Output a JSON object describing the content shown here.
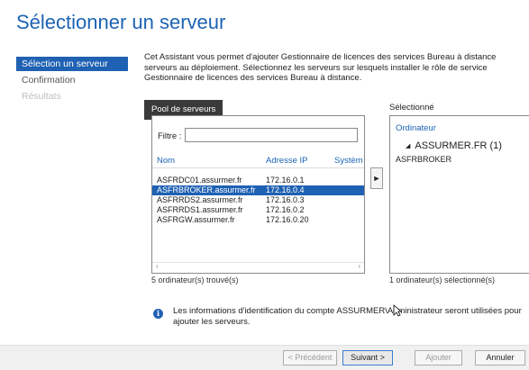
{
  "page": {
    "title": "Sélectionner un serveur"
  },
  "steps": [
    {
      "label": "Sélection un serveur",
      "state": "active"
    },
    {
      "label": "Confirmation",
      "state": "normal"
    },
    {
      "label": "Résultats",
      "state": "disabled"
    }
  ],
  "description": "Cet Assistant vous permet d'ajouter Gestionnaire de licences des services Bureau à distance serveurs au déploiement. Sélectionnez les serveurs sur lesquels installer le rôle de service Gestionnaire de licences des services Bureau à distance.",
  "pool": {
    "tab_label": "Pool de serveurs",
    "filter_label": "Filtre :",
    "filter_value": "",
    "columns": [
      "Nom",
      "Adresse IP",
      "Systèm"
    ],
    "rows": [
      {
        "name": "ASFRDC01.assurmer.fr",
        "ip": "172.16.0.1",
        "selected": false
      },
      {
        "name": "ASFRBROKER.assurmer.fr",
        "ip": "172.16.0.4",
        "selected": true
      },
      {
        "name": "ASFRRDS2.assurmer.fr",
        "ip": "172.16.0.3",
        "selected": false
      },
      {
        "name": "ASFRRDS1.assurmer.fr",
        "ip": "172.16.0.2",
        "selected": false
      },
      {
        "name": "ASFRGW.assurmer.fr",
        "ip": "172.16.0.20",
        "selected": false
      }
    ],
    "scroll_left": "‹",
    "scroll_right": "›",
    "count_text": "5 ordinateur(s) trouvé(s)"
  },
  "add_arrow": "►",
  "selected": {
    "title": "Sélectionné",
    "column": "Ordinateur",
    "group_toggle": "◢",
    "group": "ASSURMER.FR (1)",
    "items": [
      "ASFRBROKER"
    ],
    "count_text": "1 ordinateur(s) sélectionné(s)"
  },
  "info": {
    "icon": "info-icon",
    "glyph": "i",
    "text": "Les informations d'identification du compte ASSURMER\\Administrateur seront utilisées pour ajouter les serveurs."
  },
  "buttons": {
    "previous": "< Précédent",
    "next": "Suivant >",
    "add": "Ajouter",
    "cancel": "Annuler"
  },
  "colors": {
    "accent": "#1f61b3",
    "title": "#1c63b4"
  }
}
